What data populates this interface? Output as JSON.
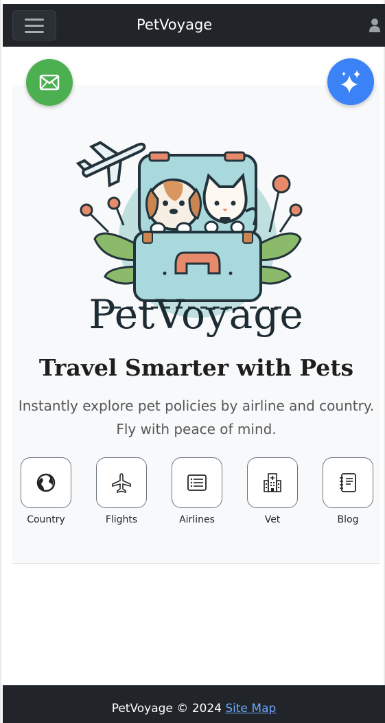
{
  "navbar": {
    "brand": "PetVoyage",
    "toggle_icon": "hamburger-menu-icon",
    "user_icon": "user-icon"
  },
  "fabs": {
    "mail_icon": "envelope-icon",
    "ai_icon": "sparkles-icon"
  },
  "hero": {
    "logo_text": "PetVoyage",
    "headline": "Travel Smarter with Pets",
    "subline_1": "Instantly explore pet policies by airline and country.",
    "subline_2": "Fly with peace of mind."
  },
  "tiles": [
    {
      "label": "Country",
      "icon": "globe-icon"
    },
    {
      "label": "Flights",
      "icon": "airplane-icon"
    },
    {
      "label": "Airlines",
      "icon": "list-icon"
    },
    {
      "label": "Vet",
      "icon": "hospital-icon"
    },
    {
      "label": "Blog",
      "icon": "notebook-icon"
    }
  ],
  "footer": {
    "text": "PetVoyage © 2024",
    "link": "Site Map"
  },
  "colors": {
    "navbar": "#212529",
    "mail_fab": "#4caf50",
    "ai_fab": "#3b82f6",
    "hero_bg": "#f8f9fa",
    "link": "#6ea8fe"
  }
}
